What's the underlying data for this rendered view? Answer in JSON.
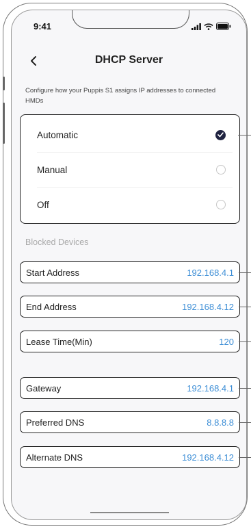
{
  "status": {
    "time": "9:41"
  },
  "nav": {
    "title": "DHCP Server"
  },
  "description": "Configure how your Puppis S1 assigns IP addresses to connected HMDs",
  "modes": [
    {
      "label": "Automatic",
      "selected": true
    },
    {
      "label": "Manual",
      "selected": false
    },
    {
      "label": "Off",
      "selected": false
    }
  ],
  "section_title": "Blocked Devices",
  "fields": [
    {
      "label": "Start Address",
      "value": "192.168.4.1"
    },
    {
      "label": "End Address",
      "value": "192.168.4.12"
    },
    {
      "label": "Lease Time(Min)",
      "value": "120"
    },
    {
      "label": "Gateway",
      "value": "192.168.4.1"
    },
    {
      "label": "Preferred DNS",
      "value": "8.8.8.8"
    },
    {
      "label": "Alternate DNS",
      "value": "192.168.4.12"
    }
  ],
  "colors": {
    "accent": "#3d8ed6",
    "selected_radio": "#1f2340",
    "background": "#f7f7f9"
  },
  "icons": [
    "back-chevron-icon",
    "signal-icon",
    "wifi-icon",
    "battery-icon",
    "checkmark-icon"
  ]
}
